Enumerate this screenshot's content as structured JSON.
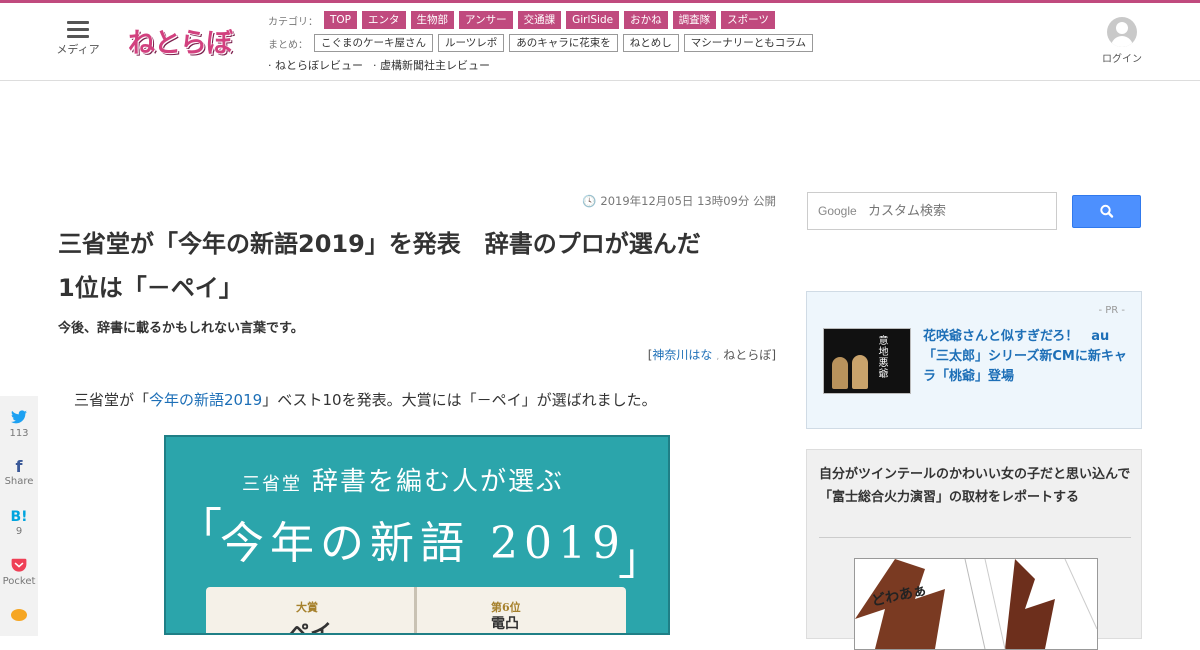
{
  "header": {
    "menu_label": "メディア",
    "logo_text": "ねとらぼ",
    "login_label": "ログイン",
    "category_label": "カテゴリ：",
    "categories": [
      "TOP",
      "エンタ",
      "生物部",
      "アンサー",
      "交通課",
      "GirlSide",
      "おかね",
      "調査隊",
      "スポーツ"
    ],
    "matome_label": "まとめ：",
    "matome": [
      "こぐまのケーキ屋さん",
      "ルーツレポ",
      "あのキャラに花束を",
      "ねとめし",
      "マシーナリーともコラム"
    ],
    "reviews": [
      "ねとらぼレビュー",
      "虚構新聞社主レビュー"
    ]
  },
  "article": {
    "date": "2019年12月05日 13時09分 公開",
    "title_line1": "三省堂が「今年の新語2019」を発表　辞書のプロが選んだ",
    "title_line2": "1位は「－ペイ」",
    "subtitle": "今後、辞書に載るかもしれない言葉です。",
    "author_name": "神奈川はな",
    "author_site": "ねとらぼ",
    "lead_pre": "三省堂が「",
    "lead_link": "今年の新語2019",
    "lead_post": "」ベスト10を発表。大賞には「－ペイ」が選ばれました。"
  },
  "hero": {
    "line1_small": "三省堂",
    "line1": "辞書を編む人が選ぶ",
    "line2": "今年の新語 2019",
    "bracket_open": "「",
    "bracket_close": "」",
    "page_left_label": "大賞",
    "page_left_word": "ペイ",
    "page_right_label": "第6位",
    "page_right_word": "電凸"
  },
  "share": {
    "twitter_icon": "twitter-icon",
    "twitter_count": "113",
    "facebook_label": "Share",
    "hatena_icon": "B!",
    "hatena_count": "9",
    "pocket_label": "Pocket"
  },
  "sidebar": {
    "search_placeholder": "カスタム検索",
    "search_brand": "Google",
    "pr_label": "- PR -",
    "pr_thumb_text": "意地悪爺",
    "pr_title": "花咲爺さんと似すぎだろ！　au「三太郎」シリーズ新CMに新キャラ「桃爺」登場",
    "article2_title": "自分がツインテールのかわいい女の子だと思い込んで「富士総合火力演習」の取材をレポートする",
    "manga_text": "どわあぁ"
  },
  "colors": {
    "brand": "#c04a7e",
    "link": "#1d6fb7",
    "hero_teal": "#2ba5ab",
    "search_button": "#4d90fe"
  }
}
